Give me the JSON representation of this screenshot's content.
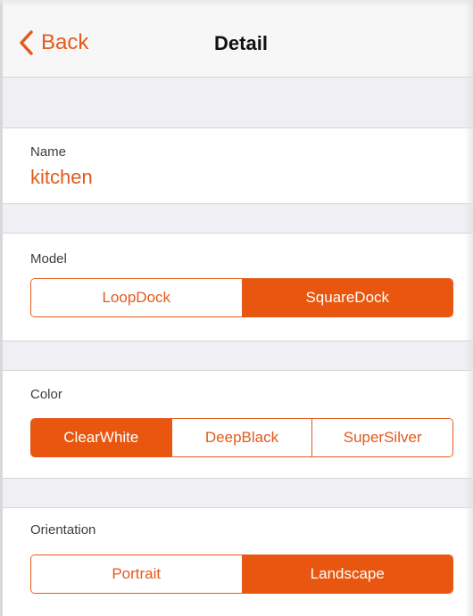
{
  "nav": {
    "back_label": "Back",
    "title": "Detail"
  },
  "name_section": {
    "label": "Name",
    "value": "kitchen"
  },
  "model_section": {
    "label": "Model",
    "options": [
      "LoopDock",
      "SquareDock"
    ],
    "selected": "SquareDock"
  },
  "color_section": {
    "label": "Color",
    "options": [
      "ClearWhite",
      "DeepBlack",
      "SuperSilver"
    ],
    "selected": "ClearWhite"
  },
  "orientation_section": {
    "label": "Orientation",
    "options": [
      "Portrait",
      "Landscape"
    ],
    "selected": "Landscape"
  },
  "colors": {
    "accent": "#e8560f",
    "accent_text": "#e35a1c",
    "group_background": "#efeff4",
    "navbar_background": "#f7f7f7"
  },
  "icons": {
    "back": "chevron-left-icon"
  }
}
